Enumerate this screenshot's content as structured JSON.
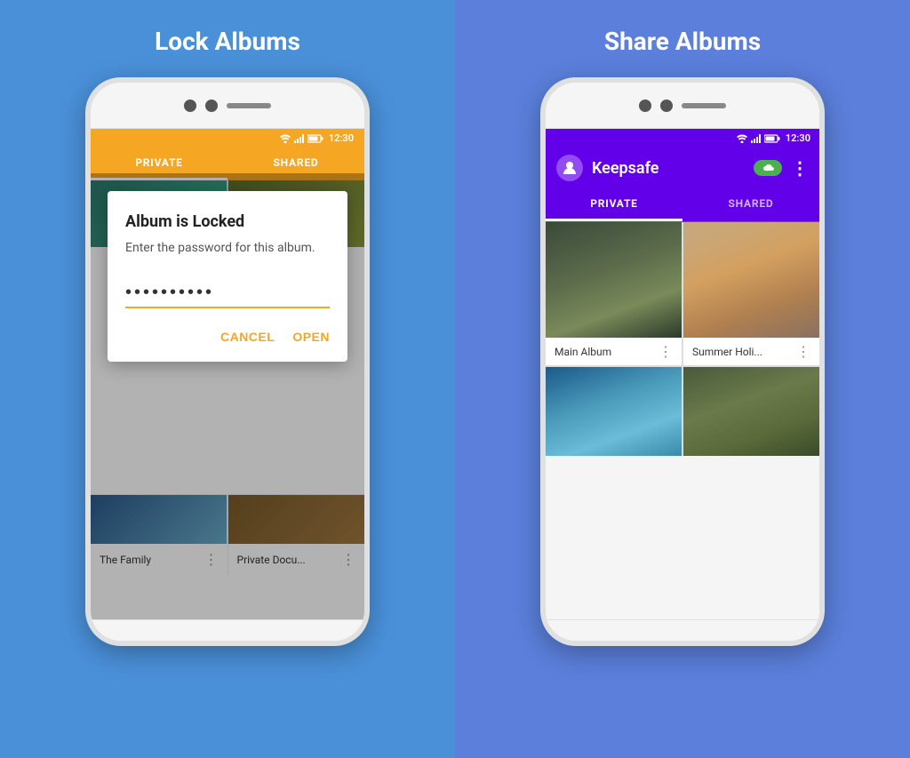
{
  "left_panel": {
    "title": "Lock Albums",
    "background": "#4A90D9",
    "phone": {
      "status_time": "12:30",
      "tabs": [
        "PRIVATE",
        "SHARED"
      ],
      "active_tab": "PRIVATE",
      "dialog": {
        "title": "Album is Locked",
        "subtitle": "Enter the password for this album.",
        "password_dots": "••••••••••",
        "cancel_label": "CANCEL",
        "open_label": "OPEN"
      },
      "albums_bottom": [
        {
          "name": "The Family",
          "id": "album-the-family"
        },
        {
          "name": "Private Docu...",
          "id": "album-private-docu"
        }
      ]
    }
  },
  "right_panel": {
    "title": "Share Albums",
    "background": "#5B7FDB",
    "phone": {
      "status_time": "12:30",
      "app_name": "Keepsafe",
      "tabs": [
        "PRIVATE",
        "SHARED"
      ],
      "active_tab": "PRIVATE",
      "albums": [
        {
          "name": "Main Album",
          "id": "album-main"
        },
        {
          "name": "Summer Holi...",
          "id": "album-summer"
        },
        {
          "name": "",
          "id": "album-pool"
        },
        {
          "name": "",
          "id": "album-lying"
        }
      ]
    }
  }
}
